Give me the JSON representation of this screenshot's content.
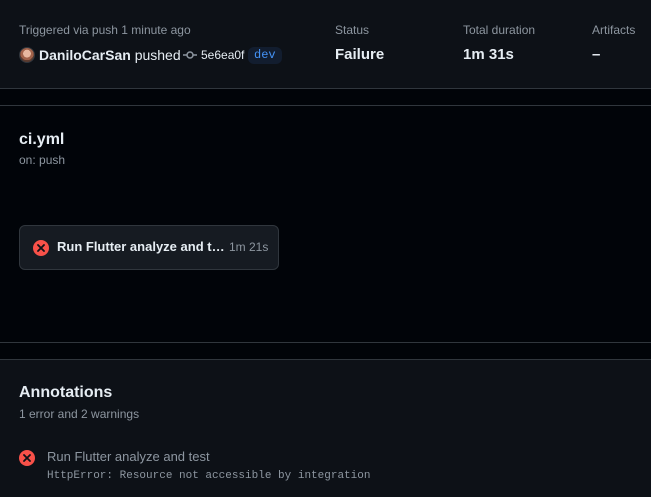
{
  "summary": {
    "trigger_text": "Triggered via push 1 minute ago",
    "actor": "DaniloCarSan",
    "action": "pushed",
    "commit_sha": "5e6ea0f",
    "branch": "dev",
    "status_label": "Status",
    "status_value": "Failure",
    "duration_label": "Total duration",
    "duration_value": "1m 31s",
    "artifacts_label": "Artifacts",
    "artifacts_value": "–"
  },
  "workflow": {
    "name": "ci.yml",
    "trigger": "on: push",
    "jobs": [
      {
        "name": "Run Flutter analyze and test",
        "duration": "1m 21s",
        "status": "failure"
      }
    ]
  },
  "annotations": {
    "title": "Annotations",
    "summary": "1 error and 2 warnings",
    "items": [
      {
        "level": "error",
        "title": "Run Flutter analyze and test",
        "message": "HttpError: Resource not accessible by integration"
      }
    ]
  },
  "colors": {
    "failure": "#f85149",
    "accent": "#4493f8"
  },
  "icons": {
    "commit": "git-commit-icon",
    "failure": "x-circle-fill-icon"
  }
}
